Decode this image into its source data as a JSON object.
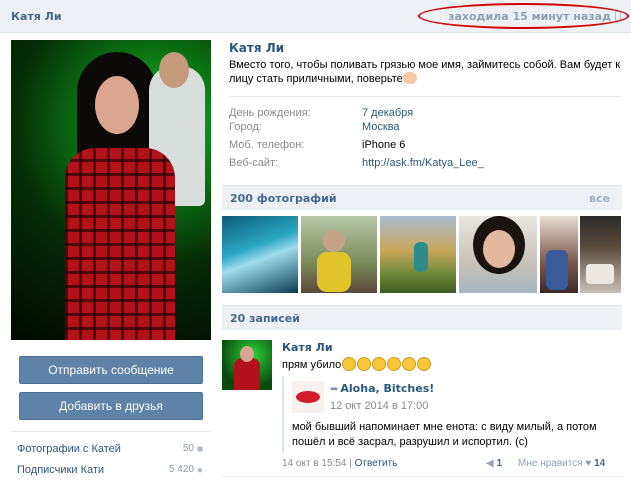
{
  "header": {
    "name": "Катя Ли",
    "status": "заходила 15 минут назад"
  },
  "sidebar": {
    "send_message": "Отправить сообщение",
    "add_friend": "Добавить в друзья",
    "links": [
      {
        "label": "Фотографии с Катей",
        "count": "50"
      },
      {
        "label": "Подписчики Кати",
        "count": "5 420"
      }
    ]
  },
  "profile": {
    "name": "Катя Ли",
    "status": "Вместо того, чтобы поливать грязью мое имя, займитесь собой. Вам будет к лицу стать приличными, поверьте",
    "fields": [
      {
        "label": "День рождения:",
        "value": "7 декабря"
      },
      {
        "label": "Город:",
        "value": "Москва"
      },
      {
        "label": "Моб. телефон:",
        "value": "iPhone 6"
      },
      {
        "label": "Веб-сайт:",
        "value": "http://ask.fm/Katya_Lee_"
      }
    ]
  },
  "photos": {
    "title": "200 фотографий",
    "all": "все"
  },
  "wall": {
    "title": "20 записей",
    "post": {
      "author": "Катя Ли",
      "text": "прям убило",
      "repost": {
        "author": "Aloha, Bitches!",
        "date": "12 окт 2014 в 17:00",
        "text": "мой бывший напоминает мне енота: с виду милый, а потом пошёл и всё засрал, разрушил и испортил. (с)"
      },
      "date": "14 окт в 15:54",
      "reply": "Ответить",
      "shares": "1",
      "likes_label": "Мне нравится",
      "likes": "14"
    }
  },
  "colors": {
    "header_bg": "#edf1f5",
    "link": "#2b587a",
    "button": "#5e82a8",
    "highlight_oval": "#d30000"
  }
}
